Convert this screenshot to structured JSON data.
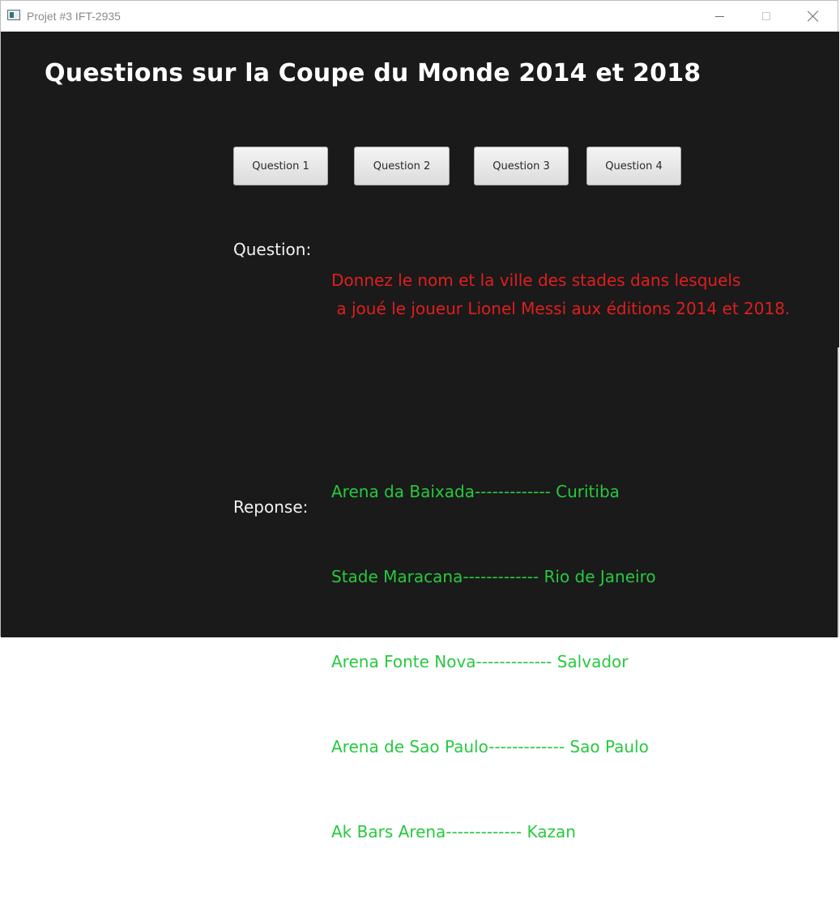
{
  "window": {
    "title": "Projet #3 IFT-2935",
    "icon": "app-window-icon",
    "controls": [
      "minimize-icon",
      "maximize-icon",
      "close-icon"
    ]
  },
  "header": {
    "title": "Questions sur la Coupe du Monde 2014 et 2018"
  },
  "buttons": [
    {
      "label": "Question 1"
    },
    {
      "label": "Question 2"
    },
    {
      "label": "Question 3"
    },
    {
      "label": "Question 4"
    }
  ],
  "question": {
    "label": "Question:",
    "line1": "Donnez le nom et la ville des stades dans lesquels",
    "line2": " a joué le joueur Lionel Messi aux éditions 2014 et 2018."
  },
  "response": {
    "label": "Reponse:",
    "lines": [
      "Arena da Baixada------------- Curitiba",
      "Stade Maracana------------- Rio de Janeiro",
      "Arena Fonte Nova------------- Salvador",
      "Arena de Sao Paulo------------- Sao Paulo",
      "Ak Bars Arena------------- Kazan"
    ]
  },
  "colors": {
    "background": "#1a1a1a",
    "question_text": "#e01e1e",
    "answer_text": "#27c93f",
    "label_text": "#f2f2f2"
  }
}
